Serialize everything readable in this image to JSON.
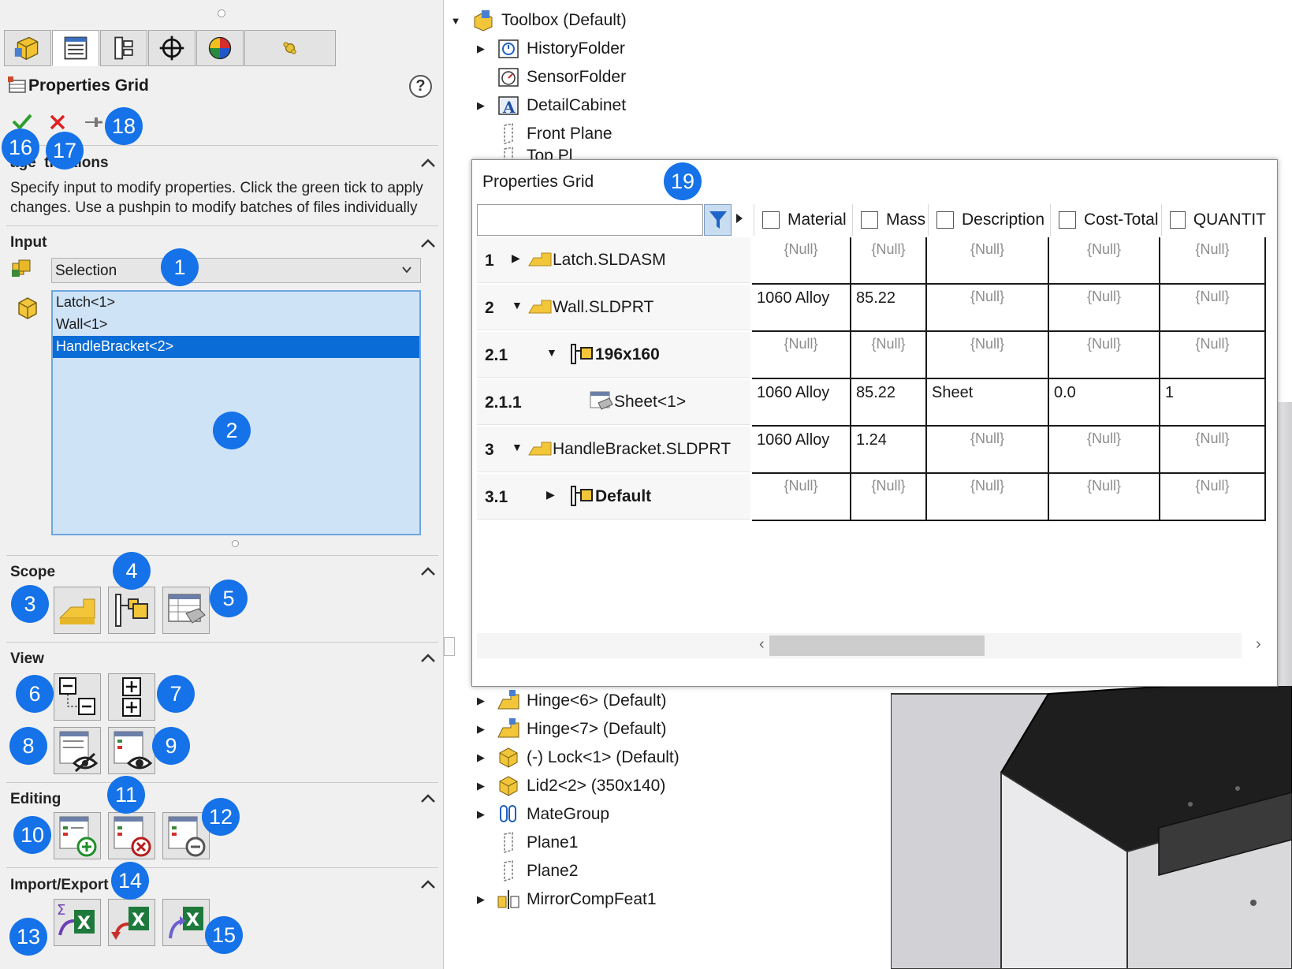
{
  "left_panel": {
    "tabs": [
      "feature-manager-icon",
      "property-manager-icon",
      "configuration-manager-icon",
      "dimxpert-icon",
      "display-manager-icon",
      "addin-icon"
    ],
    "title": "Properties Grid",
    "help_label": "?",
    "message_section": {
      "title": "Usage Instructions",
      "title_visible": "age  tructions",
      "text": "Specify input to modify properties. Click the green tick to apply changes. Use a pushpin to modify batches of files individually"
    },
    "input_section": {
      "title": "Input",
      "combo_value": "Selection",
      "selection_items": [
        "Latch<1>",
        "Wall<1>",
        "HandleBracket<2>"
      ],
      "selected_index": 2
    },
    "scope_section": {
      "title": "Scope"
    },
    "view_section": {
      "title": "View"
    },
    "editing_section": {
      "title": "Editing"
    },
    "import_export_section": {
      "title": "Import/Export"
    }
  },
  "badges": {
    "b1": "1",
    "b2": "2",
    "b3": "3",
    "b4": "4",
    "b5": "5",
    "b6": "6",
    "b7": "7",
    "b8": "8",
    "b9": "9",
    "b10": "10",
    "b11": "11",
    "b12": "12",
    "b13": "13",
    "b14": "14",
    "b15": "15",
    "b16": "16",
    "b17": "17",
    "b18": "18",
    "b19": "19"
  },
  "tree": {
    "top_items": [
      {
        "label": "Toolbox (Default)",
        "expander": "▼"
      },
      {
        "label": "HistoryFolder",
        "expander": "▶"
      },
      {
        "label": "SensorFolder",
        "expander": ""
      },
      {
        "label": "DetailCabinet",
        "expander": "▶"
      },
      {
        "label": "Front Plane",
        "expander": ""
      },
      {
        "label": "Top Pl",
        "expander": ""
      }
    ],
    "bottom_items": [
      {
        "label": "Hinge<6> (Default)",
        "expander": "▶"
      },
      {
        "label": "Hinge<7> (Default)",
        "expander": "▶"
      },
      {
        "label": "(-) Lock<1> (Default)",
        "expander": "▶"
      },
      {
        "label": "Lid2<2> (350x140)",
        "expander": "▶"
      },
      {
        "label": "MateGroup",
        "expander": "▶"
      },
      {
        "label": "Plane1",
        "expander": ""
      },
      {
        "label": "Plane2",
        "expander": ""
      },
      {
        "label": "MirrorCompFeat1",
        "expander": "▶"
      }
    ]
  },
  "grid": {
    "title": "Properties Grid",
    "filter_text": "",
    "columns": [
      "Material",
      "Mass",
      "Description",
      "Cost-Total",
      "QUANTIT"
    ],
    "rows": [
      {
        "num": "1",
        "expander": "▶",
        "name": "Latch.SLDASM",
        "bold": false,
        "cells": [
          "{Null}",
          "{Null}",
          "{Null}",
          "{Null}",
          "{Null}"
        ]
      },
      {
        "num": "2",
        "expander": "▼",
        "name": "Wall.SLDPRT",
        "bold": false,
        "cells": [
          "1060 Alloy",
          "85.22",
          "{Null}",
          "{Null}",
          "{Null}"
        ]
      },
      {
        "num": "2.1",
        "expander": "▼",
        "name": "196x160",
        "bold": true,
        "cells": [
          "{Null}",
          "{Null}",
          "{Null}",
          "{Null}",
          "{Null}"
        ]
      },
      {
        "num": "2.1.1",
        "expander": "",
        "name": "Sheet<1>",
        "bold": false,
        "cells": [
          "1060 Alloy",
          "85.22",
          "Sheet",
          "0.0",
          "1"
        ]
      },
      {
        "num": "3",
        "expander": "▼",
        "name": "HandleBracket.SLDPRT",
        "bold": false,
        "cells": [
          "1060 Alloy",
          "1.24",
          "{Null}",
          "{Null}",
          "{Null}"
        ]
      },
      {
        "num": "3.1",
        "expander": "▶",
        "name": "Default",
        "bold": true,
        "cells": [
          "{Null}",
          "{Null}",
          "{Null}",
          "{Null}",
          "{Null}"
        ]
      }
    ]
  },
  "colors": {
    "badge": "#1572e8",
    "selection_bg": "#cfe3f6",
    "selected_item": "#0a6cd6",
    "ok_green": "#2e9e2e",
    "cancel_red": "#e02020"
  }
}
